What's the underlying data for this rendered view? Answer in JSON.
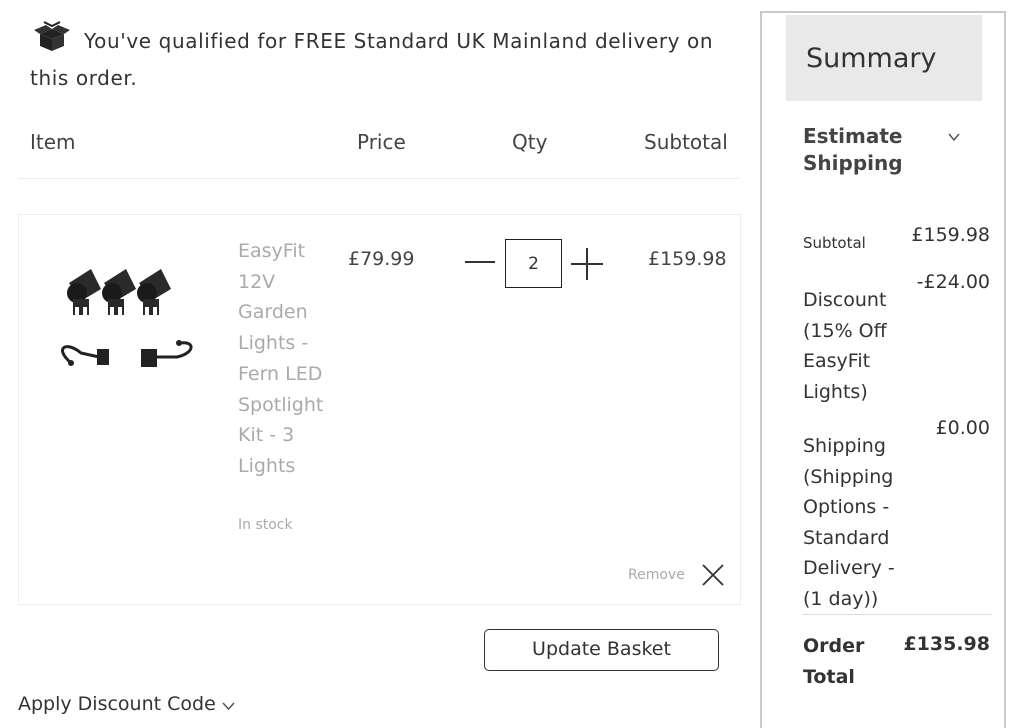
{
  "notice": {
    "text": "You've qualified for FREE Standard UK Mainland delivery on this order."
  },
  "columns": {
    "item": "Item",
    "price": "Price",
    "qty": "Qty",
    "subtotal": "Subtotal"
  },
  "cart_item": {
    "name": "EasyFit 12V Garden Lights - Fern LED Spotlight Kit - 3 Lights",
    "stock": "In stock",
    "price": "£79.99",
    "qty": "2",
    "subtotal": "£159.98",
    "remove_label": "Remove"
  },
  "actions": {
    "update_label": "Update Basket",
    "discount_label": "Apply Discount Code"
  },
  "summary": {
    "title": "Summary",
    "estimate_shipping": "Estimate Shipping",
    "subtotal_label": "Subtotal",
    "subtotal_value": "£159.98",
    "discount_label": "Discount (15% Off EasyFit Lights)",
    "discount_value": "-£24.00",
    "shipping_label": "Shipping (Shipping Options - Standard Delivery -(1 day))",
    "shipping_value": "£0.00",
    "total_label": "Order Total",
    "total_value": "£135.98"
  },
  "icons": {
    "delivery": "delivery-box-icon",
    "remove": "close-icon",
    "chevron": "chevron-down-icon"
  },
  "colors": {
    "text": "#333333",
    "muted": "#aaaaaa",
    "summary_bg": "#e9e9e9"
  }
}
